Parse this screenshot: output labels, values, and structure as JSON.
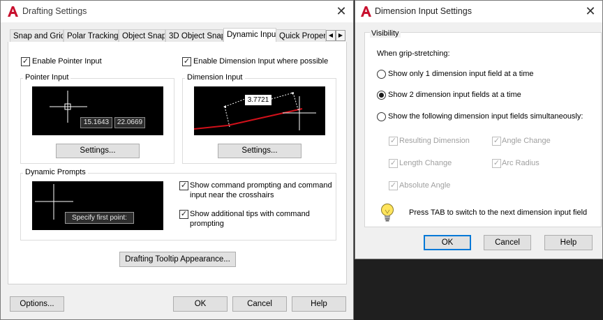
{
  "drafting": {
    "title": "Drafting Settings",
    "close": "✕",
    "tabs": [
      "Snap and Grid",
      "Polar Tracking",
      "Object Snap",
      "3D Object Snap",
      "Dynamic Input",
      "Quick Propert"
    ],
    "active_tab": "Dynamic Input",
    "scroll_left": "◀",
    "scroll_right": "▶",
    "enable_pointer_input": "Enable Pointer Input",
    "enable_dimension_input": "Enable Dimension Input where possible",
    "pointer_input": {
      "legend": "Pointer Input",
      "coord_x": "15.1643",
      "coord_y": "22.0669",
      "settings": "Settings..."
    },
    "dimension_input": {
      "legend": "Dimension Input",
      "value": "3.7721",
      "settings": "Settings..."
    },
    "dynamic_prompts": {
      "legend": "Dynamic Prompts",
      "prompt": "Specify first point:",
      "show_command": "Show command prompting and command input near the crosshairs",
      "show_tips": "Show additional tips with command prompting"
    },
    "tooltip_appearance": "Drafting Tooltip Appearance...",
    "options": "Options...",
    "ok": "OK",
    "cancel": "Cancel",
    "help": "Help"
  },
  "dim_settings": {
    "title": "Dimension Input Settings",
    "close": "✕",
    "visibility": "Visibility",
    "when_grip": "When grip-stretching:",
    "radio_1": "Show only 1 dimension input field at a time",
    "radio_2": "Show 2 dimension input fields at a time",
    "radio_3": "Show the following dimension input fields simultaneously:",
    "resulting_dimension": "Resulting Dimension",
    "angle_change": "Angle Change",
    "length_change": "Length Change",
    "arc_radius": "Arc Radius",
    "absolute_angle": "Absolute Angle",
    "tip": "Press TAB to switch to the next dimension input field",
    "ok": "OK",
    "cancel": "Cancel",
    "help": "Help"
  },
  "checkmark": "✓",
  "colors": {
    "accent": "#0078d7",
    "autocad_red": "#c8102e",
    "preview_bg": "#000000"
  }
}
